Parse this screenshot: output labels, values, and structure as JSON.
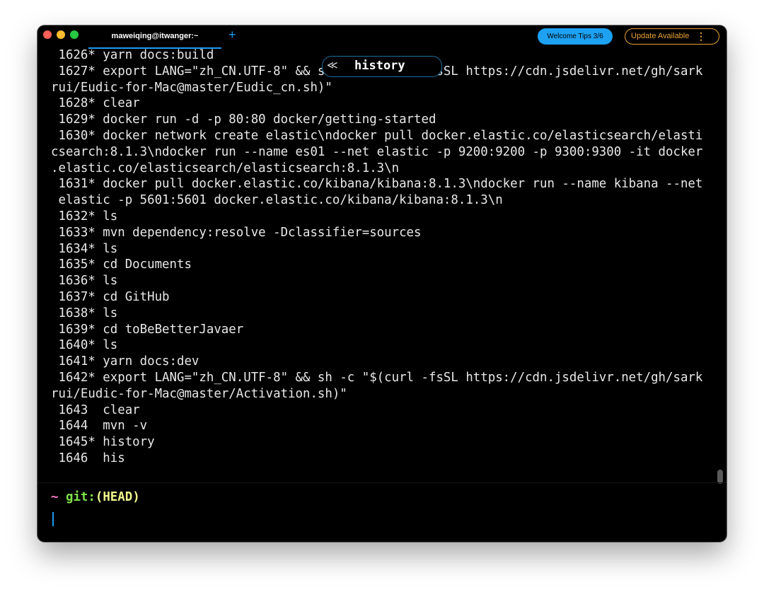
{
  "window": {
    "tab_title": "maweiqing@itwanger:~",
    "new_tab_symbol": "+",
    "welcome_tips": "Welcome Tips 3/6",
    "update_available": "Update Available",
    "kebab_symbol": "⋮"
  },
  "search": {
    "query": "history",
    "chevron": "≪"
  },
  "terminal": {
    "lines": [
      " 1626* yarn docs:build",
      " 1627* export LANG=\"zh_CN.UTF-8\" && sh -c \"$(curl -fsSL https://cdn.jsdelivr.net/gh/sark",
      "rui/Eudic-for-Mac@master/Eudic_cn.sh)\"",
      " 1628* clear",
      " 1629* docker run -d -p 80:80 docker/getting-started",
      " 1630* docker network create elastic\\ndocker pull docker.elastic.co/elasticsearch/elasti",
      "csearch:8.1.3\\ndocker run --name es01 --net elastic -p 9200:9200 -p 9300:9300 -it docker",
      ".elastic.co/elasticsearch/elasticsearch:8.1.3\\n",
      " 1631* docker pull docker.elastic.co/kibana/kibana:8.1.3\\ndocker run --name kibana --net",
      " elastic -p 5601:5601 docker.elastic.co/kibana/kibana:8.1.3\\n",
      " 1632* ls",
      " 1633* mvn dependency:resolve -Dclassifier=sources",
      " 1634* ls",
      " 1635* cd Documents",
      " 1636* ls",
      " 1637* cd GitHub",
      " 1638* ls",
      " 1639* cd toBeBetterJavaer",
      " 1640* ls",
      " 1641* yarn docs:dev",
      " 1642* export LANG=\"zh_CN.UTF-8\" && sh -c \"$(curl -fsSL https://cdn.jsdelivr.net/gh/sark",
      "rui/Eudic-for-Mac@master/Activation.sh)\"",
      " 1643  clear",
      " 1644  mvn -v",
      " 1645* history",
      " 1646  his"
    ]
  },
  "prompt": {
    "tilde": "~",
    "git": "git:",
    "branch": "(HEAD)"
  },
  "colors": {
    "accent": "#1d9bf0",
    "update": "#e8a135",
    "prompt_tilde": "#ff79c6",
    "prompt_git": "#7ee04a",
    "prompt_branch": "#f1fa8c"
  }
}
